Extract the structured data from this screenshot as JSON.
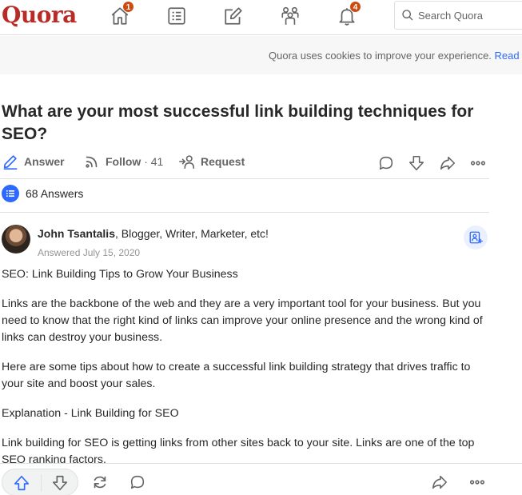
{
  "brand": {
    "logo": "Quora"
  },
  "nav": {
    "home_badge": "1",
    "notifications_badge": "4",
    "search_placeholder": "Search Quora"
  },
  "cookie_banner": {
    "text": "Quora uses cookies to improve your experience. ",
    "link": "Read m"
  },
  "question": {
    "title": "What are your most successful link building techniques for SEO?",
    "answer_label": "Answer",
    "follow_label": "Follow",
    "follow_count": "· 41",
    "request_label": "Request"
  },
  "answers_count": "68 Answers",
  "answer": {
    "author_name": "John Tsantalis",
    "author_credential": ", Blogger, Writer, Marketer, etc!",
    "date": "Answered July 15, 2020",
    "paragraphs": [
      "SEO: Link Building Tips to Grow Your Business",
      "Links are the backbone of the web and they are a very important tool for your business. But you need to know that the right kind of links can improve your online presence and the wrong kind of links can destroy your business.",
      "Here are some tips about how to create a successful link building strategy that drives traffic to your site and boost your sales.",
      "Explanation - Link Building for SEO",
      "Link building for SEO is getting links from other sites back to your site. Links are one of the top SEO ranking factors."
    ]
  },
  "colors": {
    "brand_red": "#b92b27",
    "accent_blue": "#2e69ff",
    "badge": "#cb4b10",
    "icon_gray": "#636466"
  }
}
